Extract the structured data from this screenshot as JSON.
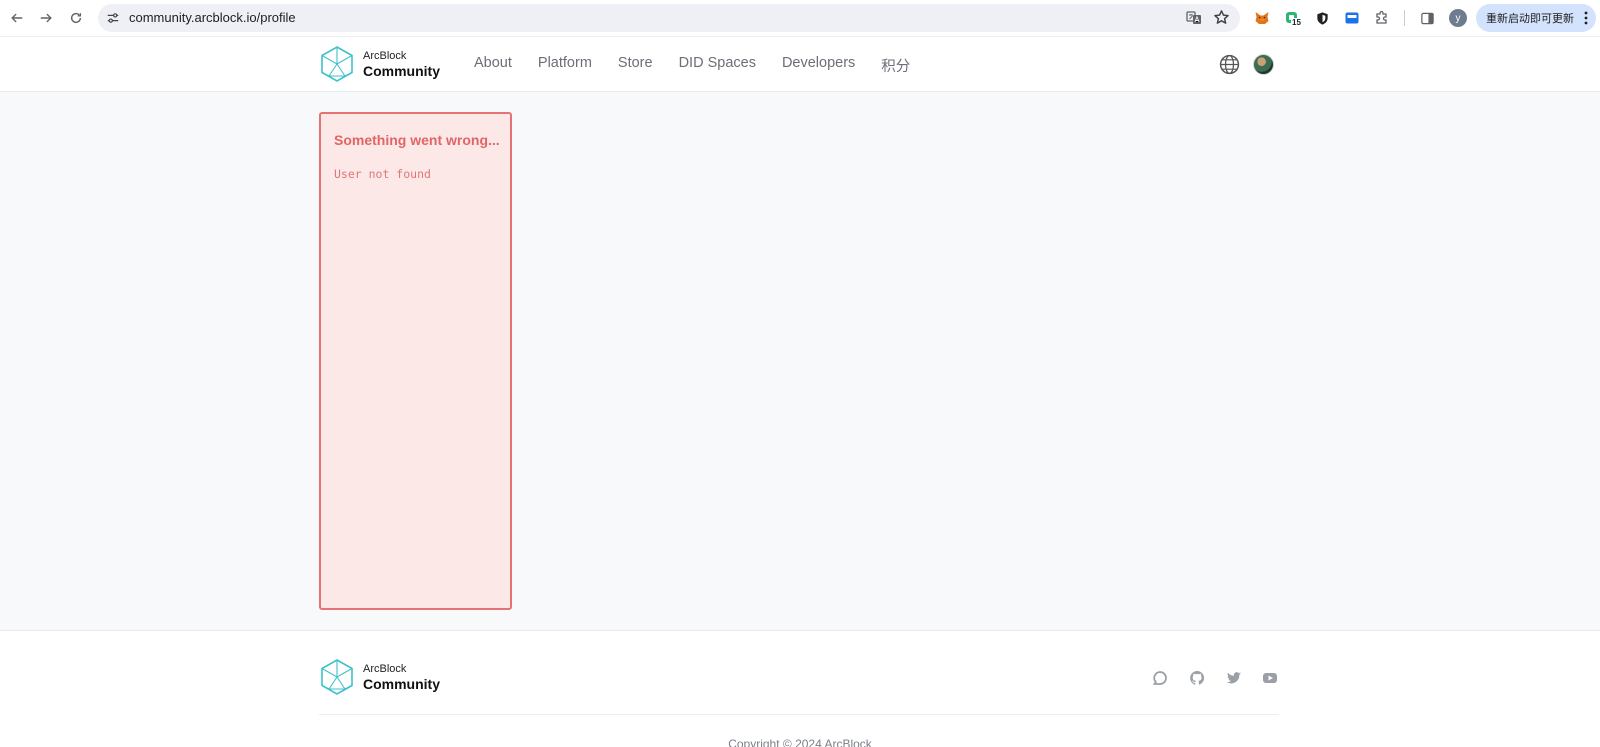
{
  "browser": {
    "url": "community.arcblock.io/profile",
    "profile_initial": "y",
    "update_label": "重新启动即可更新",
    "extension_badge": "15"
  },
  "site": {
    "logo_line1": "ArcBlock",
    "logo_line2": "Community",
    "nav": [
      "About",
      "Platform",
      "Store",
      "DID Spaces",
      "Developers",
      "积分"
    ]
  },
  "error": {
    "title": "Something went wrong...",
    "message": "User not found"
  },
  "footer": {
    "logo_line1": "ArcBlock",
    "logo_line2": "Community",
    "copyright": "Copyright © 2024 ArcBlock"
  },
  "colors": {
    "error_border": "#e57373",
    "error_bg": "#fde8e8",
    "error_text": "#e06666",
    "logo_teal": "#3fc1c9"
  }
}
